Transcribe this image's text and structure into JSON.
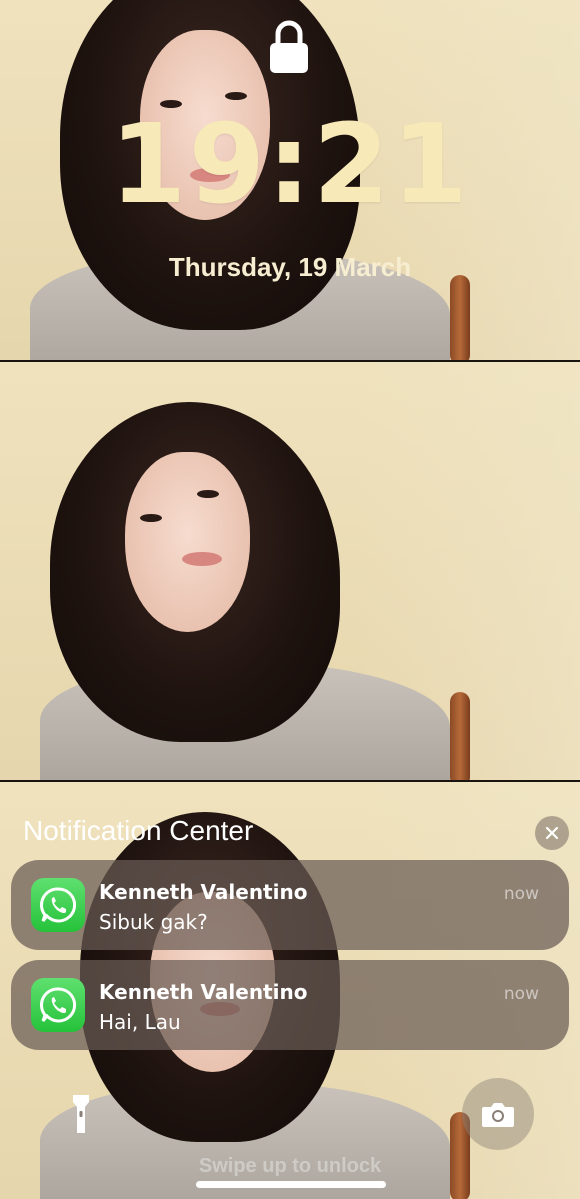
{
  "lockscreen": {
    "time": "19:21",
    "date": "Thursday, 19 March",
    "lock_icon": "lock-icon",
    "clock_color": "#f7e9b8"
  },
  "notification_center": {
    "title": "Notification Center",
    "clear_icon": "close-icon",
    "notifications": [
      {
        "app_icon": "whatsapp-icon",
        "sender": "Kenneth Valentino",
        "message": "Sibuk gak?",
        "time": "now"
      },
      {
        "app_icon": "whatsapp-icon",
        "sender": "Kenneth Valentino",
        "message": "Hai, Lau",
        "time": "now"
      }
    ]
  },
  "bottom_bar": {
    "flashlight_icon": "flashlight-icon",
    "camera_icon": "camera-icon",
    "swipe_text": "Swipe up to unlock"
  },
  "colors": {
    "whatsapp_green": "#25c23a",
    "notification_bg": "#695c55"
  }
}
